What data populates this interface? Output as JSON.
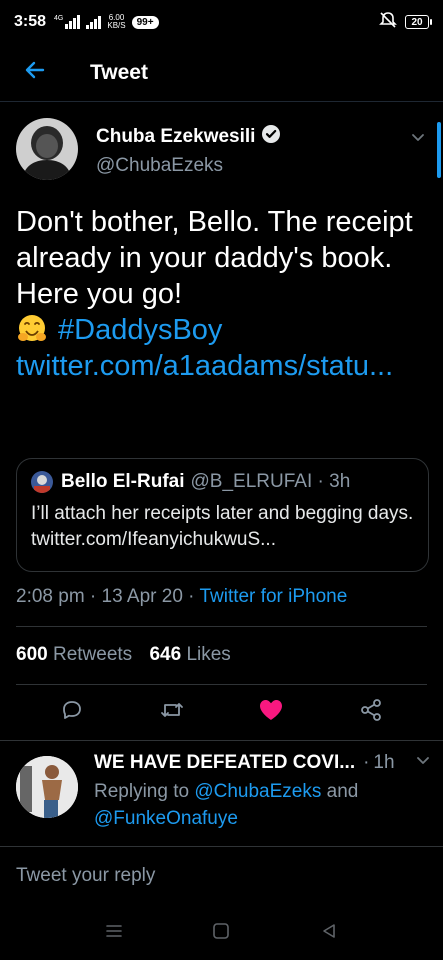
{
  "status_bar": {
    "time": "3:58",
    "signal_label": "4G",
    "net_speed_value": "6.00",
    "net_speed_unit": "KB/S",
    "notifications": "99+",
    "battery": "20"
  },
  "header": {
    "title": "Tweet"
  },
  "tweet": {
    "author_name": "Chuba Ezekwesili",
    "author_handle": "@ChubaEzeks",
    "text_plain": "Don't bother, Bello. The receipt already in your daddy's book. Here you go!",
    "hashtag": "#DaddysBoy",
    "link": "twitter.com/a1aadams/statu...",
    "time": "2:08 pm",
    "date": "13 Apr 20",
    "source": "Twitter for iPhone",
    "retweets_count": "600",
    "retweets_label": "Retweets",
    "likes_count": "646",
    "likes_label": "Likes"
  },
  "quote": {
    "name": "Bello El-Rufai",
    "handle": "@B_ELRUFAI",
    "time": "3h",
    "text": "I’ll attach her receipts later and begging days. twitter.com/IfeanyichukwuS..."
  },
  "reply": {
    "name": "WE HAVE DEFEATED COVI...",
    "time": "1h",
    "replying_prefix": "Replying to",
    "mention_1": "@ChubaEzeks",
    "conjunction": "and",
    "mention_2": "@FunkeOnafuye"
  },
  "composer": {
    "placeholder": "Tweet your reply"
  },
  "colors": {
    "accent": "#1d9bf0",
    "like": "#f91880",
    "muted": "#8b98a5",
    "background": "#000000"
  },
  "icons": [
    "back-arrow-icon",
    "verified-badge-icon",
    "chevron-down-icon",
    "reply-icon",
    "retweet-icon",
    "heart-icon",
    "share-icon",
    "menu-icon",
    "home-icon",
    "back-triangle-icon"
  ]
}
